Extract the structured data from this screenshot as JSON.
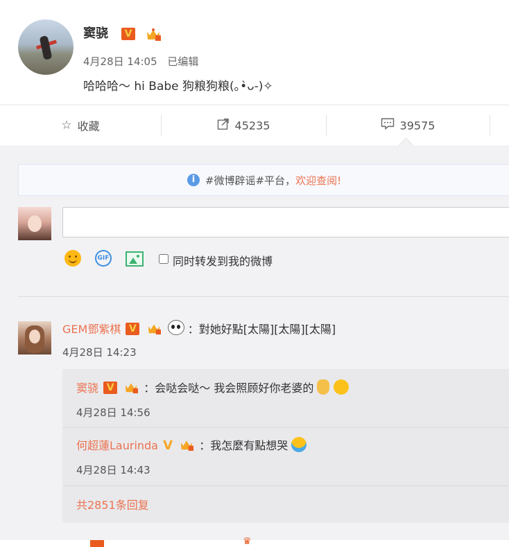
{
  "post": {
    "username": "窦骁",
    "date": "4月28日 14:05",
    "edited": "已编辑",
    "text": "哈哈哈～ hi Babe 狗粮狗粮(｡•̀ᴗ-)✧"
  },
  "actions": {
    "favorite": "收藏",
    "repost_count": "45235",
    "comment_count": "39575"
  },
  "notice": {
    "text": "#微博辟谣#平台，",
    "link": "欢迎查阅!"
  },
  "compose": {
    "placeholder": "",
    "repost_label": "同时转发到我的微博"
  },
  "comment": {
    "name": "GEM鄧紫棋",
    "text": "：對她好點[太陽][太陽][太陽]",
    "time": "4月28日 14:23"
  },
  "replies": [
    {
      "name": "窦骁",
      "text": "：会哒会哒～ 我会照顾好你老婆的",
      "time": "4月28日 14:56"
    },
    {
      "name": "何超蓮Laurinda",
      "text": "：我怎麼有點想哭",
      "time": "4月28日 14:43"
    }
  ],
  "more_replies": "共2851条回复",
  "colors": {
    "accent": "#eb7350",
    "verified_badge": "#ea5b1f",
    "info_blue": "#5b9be6"
  }
}
